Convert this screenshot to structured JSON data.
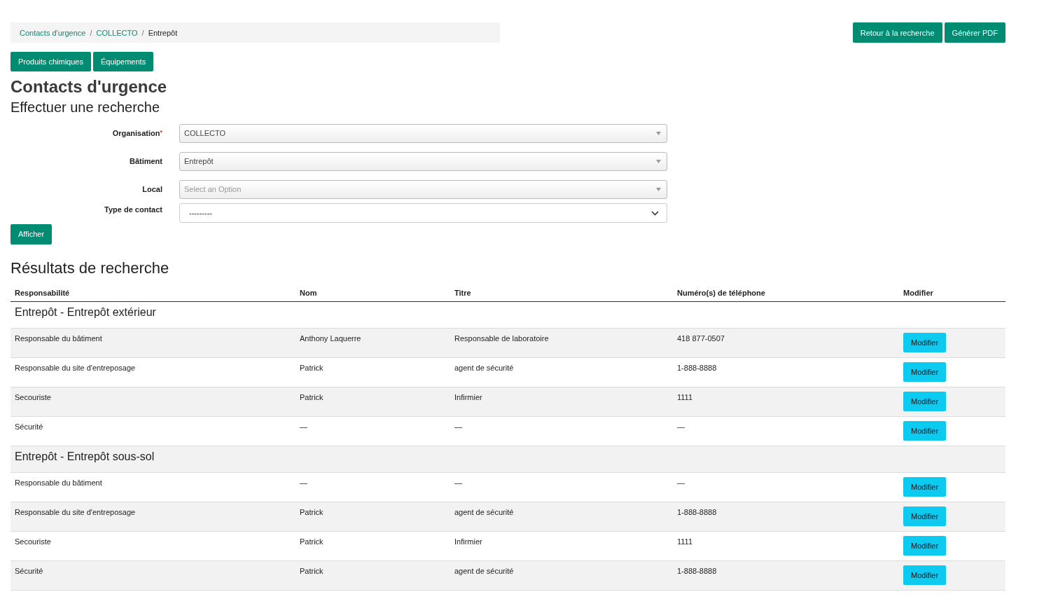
{
  "breadcrumb": [
    {
      "label": "Contacts d'urgence",
      "link": true
    },
    {
      "label": "COLLECTO",
      "link": true
    },
    {
      "label": "Entrepôt",
      "link": false
    }
  ],
  "breadcrumb_separator": "/",
  "top_buttons": [
    "Retour à la recherche",
    "Générer PDF"
  ],
  "nav_buttons": [
    "Produits chimiques",
    "Équipements"
  ],
  "title": "Contacts d'urgence",
  "subtitle": "Effectuer une recherche",
  "form": [
    {
      "label": "Organisation",
      "required": true,
      "kind": "select2",
      "value": "COLLECTO"
    },
    {
      "label": "Bâtiment",
      "required": false,
      "kind": "select2",
      "value": "Entrepôt"
    },
    {
      "label": "Local",
      "required": false,
      "kind": "select2",
      "placeholder": "Select an Option"
    },
    {
      "label": "Type de contact",
      "required": false,
      "kind": "native",
      "value": "---------"
    }
  ],
  "required_mark": "*",
  "submit_button": "Afficher",
  "results_title": "Résultats de recherche",
  "table": {
    "columns": [
      "Responsabilité",
      "Nom",
      "Titre",
      "Numéro(s) de téléphone",
      "Modifier"
    ],
    "groups": [
      {
        "title": "Entrepôt - Entrepôt extérieur",
        "rows": [
          {
            "responsabilite": "Responsable du bâtiment",
            "nom": "Anthony Laquerre",
            "titre": "Responsable de laboratoire",
            "telephone": "418 877-0507",
            "action": "Modifier"
          },
          {
            "responsabilite": "Responsable du site d'entreposage",
            "nom": "Patrick",
            "titre": "agent de sécurité",
            "telephone": "1-888-8888",
            "action": "Modifier"
          },
          {
            "responsabilite": "Secouriste",
            "nom": "Patrick",
            "titre": "Infirmier",
            "telephone": "1111",
            "action": "Modifier"
          },
          {
            "responsabilite": "Sécurité",
            "nom": "—",
            "titre": "—",
            "telephone": "—",
            "action": "Modifier"
          }
        ]
      },
      {
        "title": "Entrepôt - Entrepôt sous-sol",
        "rows": [
          {
            "responsabilite": "Responsable du bâtiment",
            "nom": "—",
            "titre": "—",
            "telephone": "—",
            "action": "Modifier"
          },
          {
            "responsabilite": "Responsable du site d'entreposage",
            "nom": "Patrick",
            "titre": "agent de sécurité",
            "telephone": "1-888-8888",
            "action": "Modifier"
          },
          {
            "responsabilite": "Secouriste",
            "nom": "Patrick",
            "titre": "Infirmier",
            "telephone": "1111",
            "action": "Modifier"
          },
          {
            "responsabilite": "Sécurité",
            "nom": "Patrick",
            "titre": "agent de sécurité",
            "telephone": "1-888-8888",
            "action": "Modifier"
          }
        ]
      }
    ]
  }
}
